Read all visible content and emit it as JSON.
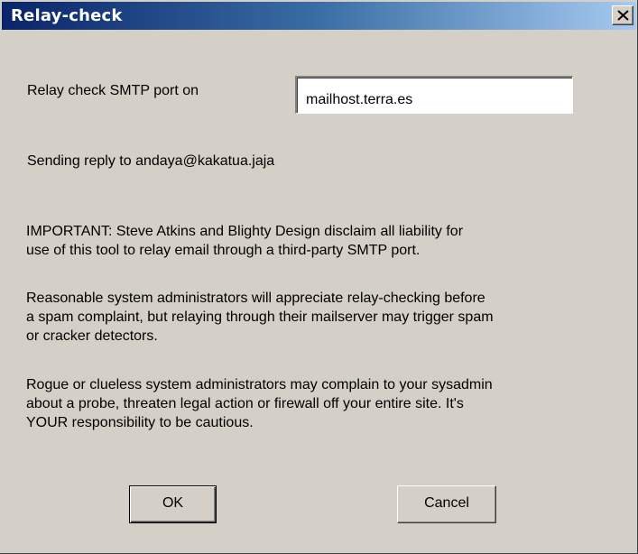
{
  "window": {
    "title": "Relay-check",
    "close_icon": "close-x-icon"
  },
  "form": {
    "host_label": "Relay check SMTP port on",
    "host_value": "mailhost.terra.es"
  },
  "messages": {
    "reply_line": "Sending reply to andaya@kakatua.jaja",
    "important": "IMPORTANT: Steve Atkins and Blighty Design disclaim all liability for\nuse of this tool to relay email through a third-party SMTP port.",
    "reasonable": "Reasonable system administrators will appreciate relay-checking before\na spam complaint, but relaying through their mailserver may trigger spam\nor cracker detectors.",
    "rogue": "Rogue or clueless system administrators may complain to your sysadmin\nabout a probe, threaten legal action or firewall off your entire site. It's\nYOUR responsibility to be cautious."
  },
  "buttons": {
    "ok_label": "OK",
    "cancel_label": "Cancel"
  },
  "colors": {
    "titlebar_start": "#0a246a",
    "titlebar_end": "#a6caf0",
    "dialog_face": "#d4d0c8"
  }
}
